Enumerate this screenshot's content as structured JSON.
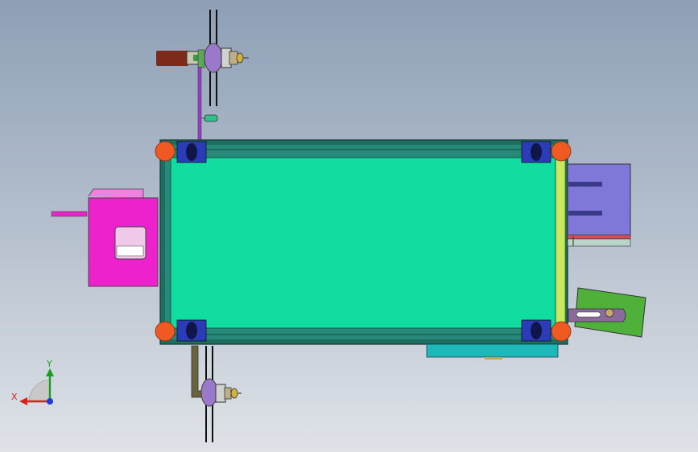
{
  "view": {
    "background_top": "#8e9fb6",
    "background_bottom": "#dfe3e8"
  },
  "colors": {
    "table_top": "#12dda0",
    "frame_dark": "#1e6e60",
    "frame_light": "#c8e860",
    "corner_foot": "#ee5a22",
    "caster": "#2a3cb8",
    "motor_housing": "#7d2a1a",
    "pulley": "#9a78cc",
    "pink_box": "#ee22cc",
    "purple_panel": "#7f78d8",
    "green_plate": "#4fb03a",
    "teal_bar": "#1fb8b8"
  },
  "triad": {
    "x_label": "X",
    "y_label": "Y"
  }
}
